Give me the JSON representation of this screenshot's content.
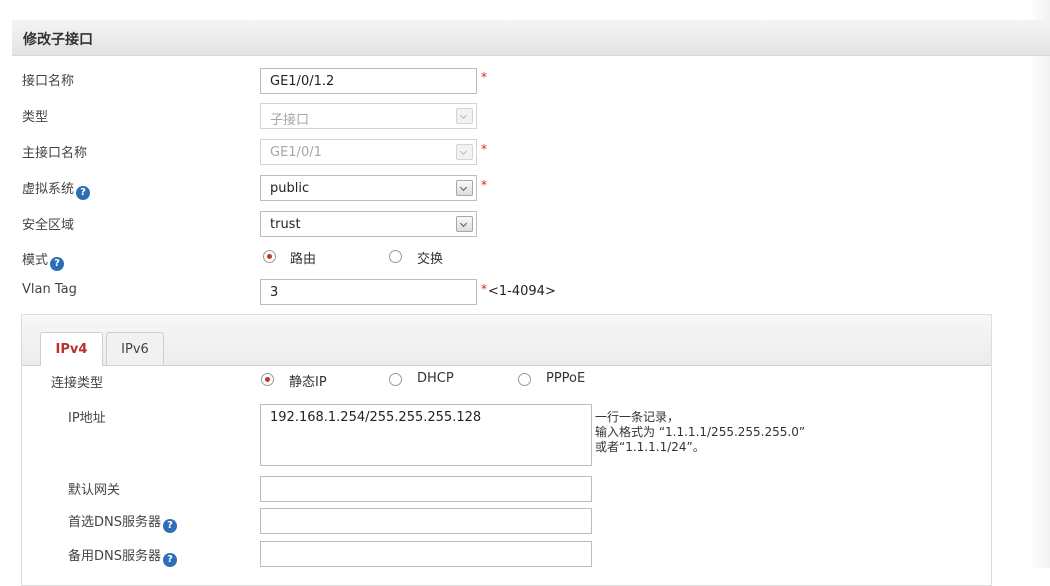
{
  "header": {
    "title": "修改子接口"
  },
  "form": {
    "interface_name": {
      "label": "接口名称",
      "value": "GE1/0/1.2",
      "required": "*"
    },
    "type": {
      "label": "类型",
      "value": "子接口"
    },
    "parent_interface": {
      "label": "主接口名称",
      "value": "GE1/0/1",
      "required": "*"
    },
    "virtual_system": {
      "label": "虚拟系统",
      "value": "public",
      "required": "*"
    },
    "security_zone": {
      "label": "安全区域",
      "value": "trust"
    },
    "mode": {
      "label": "模式",
      "options": [
        "路由",
        "交换"
      ],
      "selected": "路由"
    },
    "vlan_tag": {
      "label": "Vlan Tag",
      "value": "3",
      "required": "*",
      "range": "<1-4094>"
    }
  },
  "ip_panel": {
    "tabs": [
      "IPv4",
      "IPv6"
    ],
    "active_tab": "IPv4",
    "connection_type": {
      "label": "连接类型",
      "options": [
        "静态IP",
        "DHCP",
        "PPPoE"
      ],
      "selected": "静态IP"
    },
    "ip_address": {
      "label": "IP地址",
      "value": "192.168.1.254/255.255.255.128",
      "hint": [
        "一行一条记录，",
        "输入格式为 “1.1.1.1/255.255.255.0”",
        "或者“1.1.1.1/24”。"
      ]
    },
    "default_gateway": {
      "label": "默认网关",
      "value": ""
    },
    "primary_dns": {
      "label": "首选DNS服务器",
      "value": ""
    },
    "secondary_dns": {
      "label": "备用DNS服务器",
      "value": ""
    }
  },
  "icons": {
    "help": "?"
  },
  "colors": {
    "accent_red": "#c0392b",
    "required_red": "#e02020",
    "help_blue": "#2d6fb6",
    "active_tab_text": "#b8312f"
  }
}
